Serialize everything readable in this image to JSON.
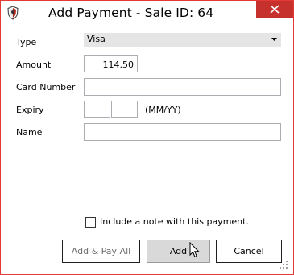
{
  "window": {
    "title": "Add Payment - Sale ID: 64"
  },
  "form": {
    "type_label": "Type",
    "type_value": "Visa",
    "amount_label": "Amount",
    "amount_value": "114.50",
    "card_number_label": "Card Number",
    "card_number_value": "",
    "expiry_label": "Expiry",
    "expiry_month_value": "",
    "expiry_year_value": "",
    "expiry_hint": "(MM/YY)",
    "name_label": "Name",
    "name_value": "",
    "include_note_label": "Include a note with this payment.",
    "include_note_checked": false
  },
  "buttons": {
    "add_pay_all": "Add & Pay All",
    "add": "Add",
    "cancel": "Cancel"
  },
  "icons": {
    "app": "shield-icon",
    "close": "close-icon",
    "dropdown": "chevron-down-icon",
    "cursor": "mouse-pointer-icon",
    "grip": "resize-grip-icon"
  },
  "colors": {
    "window_border": "#e53935",
    "close_button": "#c7312d",
    "select_bg": "#e5e5e5",
    "add_button_bg": "#d9d9d9"
  }
}
